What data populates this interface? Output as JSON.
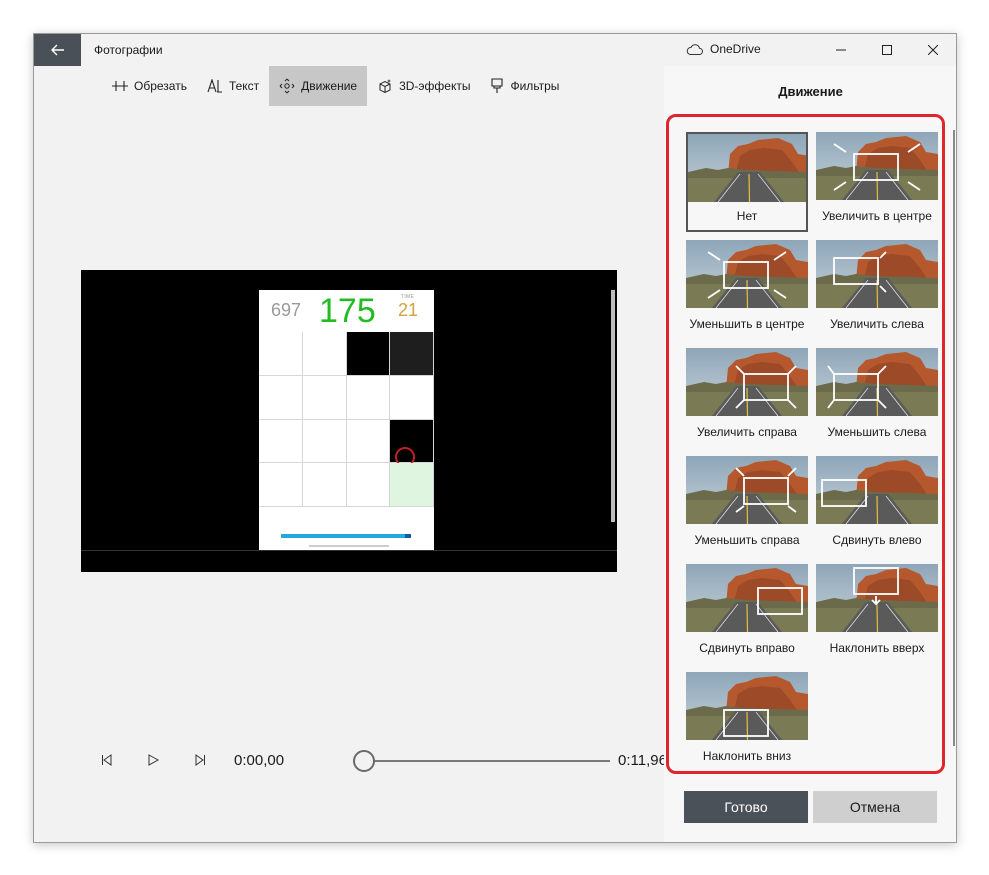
{
  "window": {
    "app_title": "Фотографии",
    "onedrive_label": "OneDrive"
  },
  "toolbar": {
    "items": [
      {
        "label": "Обрезать",
        "icon": "trim-icon"
      },
      {
        "label": "Текст",
        "icon": "text-icon"
      },
      {
        "label": "Движение",
        "icon": "motion-icon",
        "active": true
      },
      {
        "label": "3D-эффекты",
        "icon": "3d-effects-icon"
      },
      {
        "label": "Фильтры",
        "icon": "filters-icon"
      }
    ]
  },
  "preview": {
    "hud_left_value": "697",
    "hud_score_value": "175",
    "hud_time_value": "21",
    "hud_time_caption": "TIME"
  },
  "playback": {
    "current_time": "0:00,00",
    "total_time": "0:11,96",
    "progress": 0
  },
  "motion_panel": {
    "title": "Движение",
    "options": [
      {
        "label": "Нет",
        "selected": true
      },
      {
        "label": "Увеличить в центре"
      },
      {
        "label": "Уменьшить в центре"
      },
      {
        "label": "Увеличить слева"
      },
      {
        "label": "Увеличить справа"
      },
      {
        "label": "Уменьшить слева"
      },
      {
        "label": "Уменьшить справа"
      },
      {
        "label": "Сдвинуть влево"
      },
      {
        "label": "Сдвинуть вправо"
      },
      {
        "label": "Наклонить вверх"
      },
      {
        "label": "Наклонить вниз"
      }
    ],
    "done_label": "Готово",
    "cancel_label": "Отмена"
  },
  "colors": {
    "highlight": "#e0262c",
    "done_button": "#4a5158",
    "score_green": "#22bb22"
  }
}
